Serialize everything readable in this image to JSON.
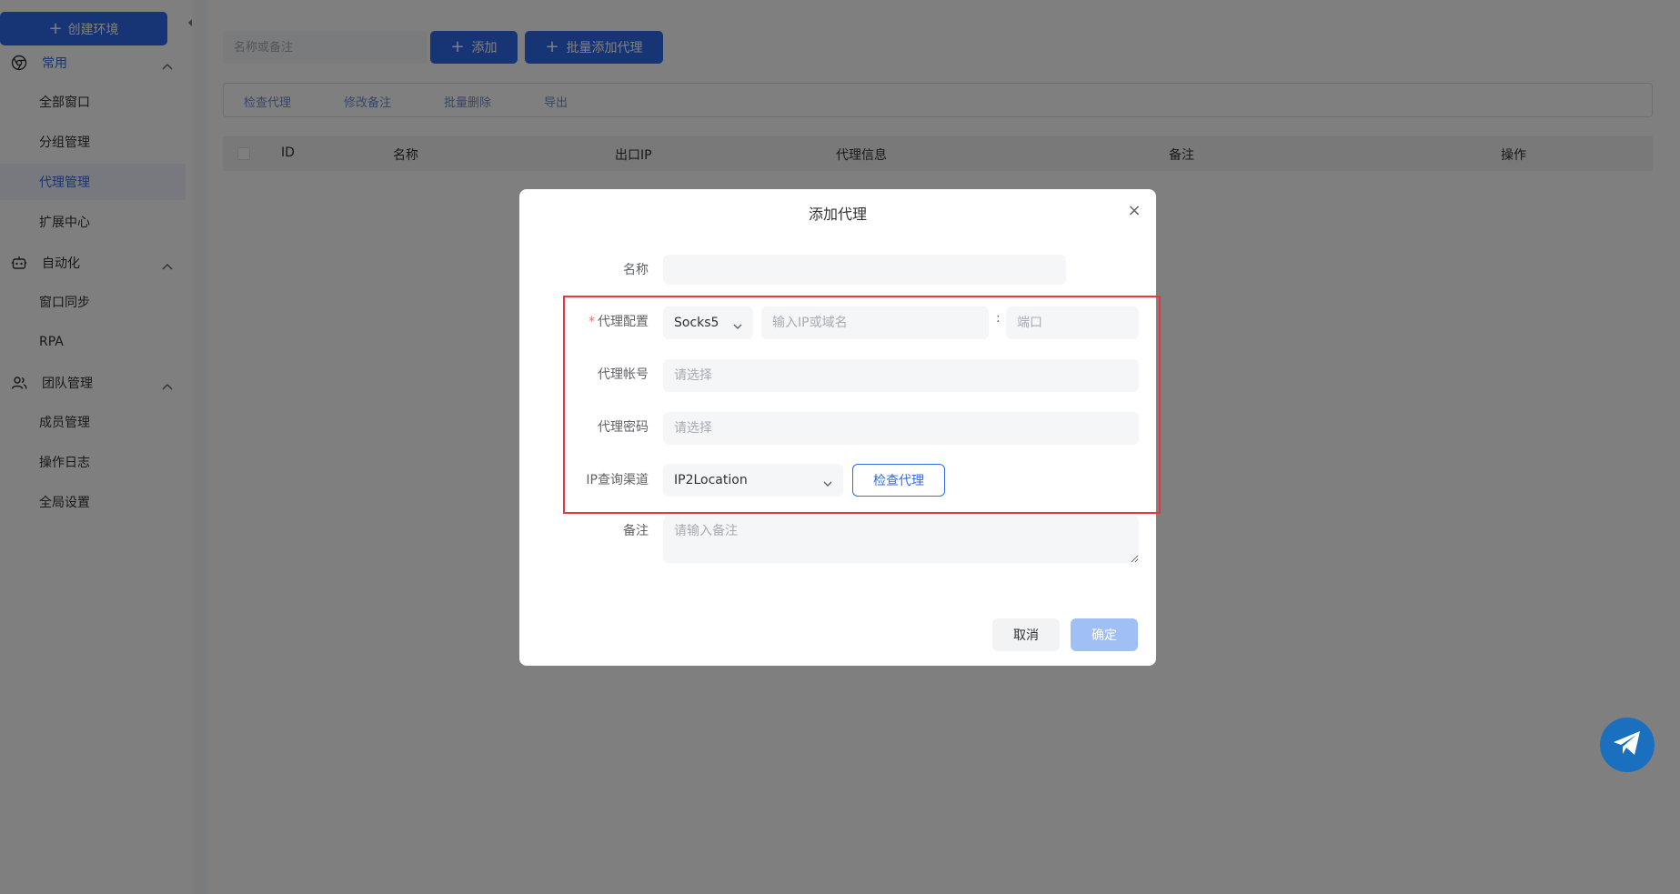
{
  "sidebar": {
    "create_button": "创建环境",
    "groups": [
      {
        "label": "常用",
        "items": [
          "全部窗口",
          "分组管理",
          "代理管理",
          "扩展中心"
        ]
      },
      {
        "label": "自动化",
        "items": [
          "窗口同步",
          "RPA"
        ]
      },
      {
        "label": "团队管理",
        "items": [
          "成员管理",
          "操作日志",
          "全局设置"
        ]
      }
    ],
    "active_item": "代理管理",
    "icons": [
      "chrome-icon",
      "robot-icon",
      "team-icon"
    ]
  },
  "toolbar": {
    "search_placeholder": "名称或备注",
    "add_button": "添加",
    "batch_add_button": "批量添加代理"
  },
  "actions": [
    "检查代理",
    "修改备注",
    "批量删除",
    "导出"
  ],
  "table": {
    "columns": [
      "ID",
      "名称",
      "出口IP",
      "代理信息",
      "备注",
      "操作"
    ]
  },
  "dialog": {
    "title": "添加代理",
    "name_label": "名称",
    "proxy_config_label": "代理配置",
    "protocol": "Socks5",
    "host_placeholder": "输入IP或域名",
    "colon": ":",
    "port_placeholder": "端口",
    "account_label": "代理帐号",
    "account_placeholder": "请选择",
    "password_label": "代理密码",
    "password_placeholder": "请选择",
    "ip_channel_label": "IP查询渠道",
    "ip_channel_value": "IP2Location",
    "check_button": "检查代理",
    "note_label": "备注",
    "note_placeholder": "请输入备注",
    "cancel_button": "取消",
    "confirm_button": "确定"
  },
  "colors": {
    "primary": "#2f6bea",
    "highlight_border": "#e8383d",
    "fab": "#1a6fbe"
  }
}
